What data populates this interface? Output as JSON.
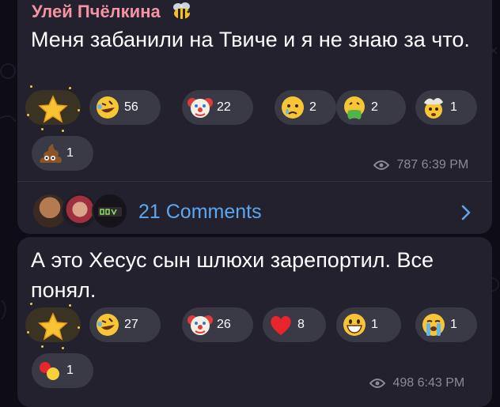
{
  "colors": {
    "background": "#0e0d16",
    "bubble": "#22212d",
    "sender": "#f592a4",
    "link": "#5ea6f0",
    "meta": "#8b8a96",
    "reaction_bg": "#3a3946"
  },
  "messages": [
    {
      "sender": "Улей Пчёлкина",
      "sender_emoji": "bee-icon",
      "text": "Меня забанили на Твиче и я не знаю за что.",
      "reactions": [
        {
          "emoji": "star-icon",
          "count": ""
        },
        {
          "emoji": "rofl-emoji-icon",
          "count": "56"
        },
        {
          "emoji": "clown-emoji-icon",
          "count": "22"
        },
        {
          "emoji": "crying-face-icon",
          "count": "2"
        },
        {
          "emoji": "vomiting-face-icon",
          "count": "2"
        },
        {
          "emoji": "exploding-head-icon",
          "count": "1"
        },
        {
          "emoji": "poop-emoji-icon",
          "count": "1"
        }
      ],
      "views": "787",
      "time": "6:39 PM",
      "comments_label": "21 Comments"
    },
    {
      "text": "А это Хесус сын шлюхи зарепортил. Все понял.",
      "reactions": [
        {
          "emoji": "star-icon",
          "count": ""
        },
        {
          "emoji": "rofl-emoji-icon",
          "count": "27"
        },
        {
          "emoji": "clown-emoji-icon",
          "count": "26"
        },
        {
          "emoji": "red-heart-icon",
          "count": "8"
        },
        {
          "emoji": "grinning-face-icon",
          "count": "1"
        },
        {
          "emoji": "loudly-crying-face-icon",
          "count": "1"
        },
        {
          "emoji": "traffic-lights-icon",
          "count": "1"
        }
      ],
      "views": "498",
      "time": "6:43 PM"
    }
  ]
}
